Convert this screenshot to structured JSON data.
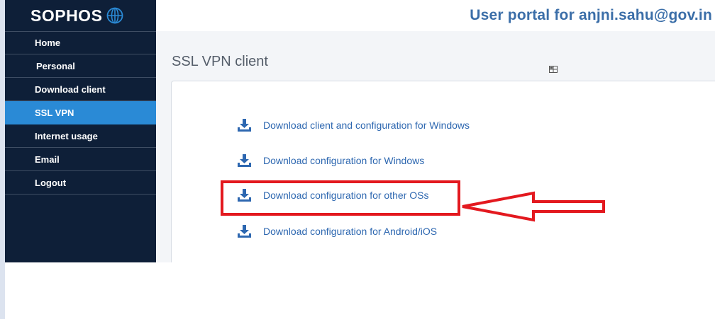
{
  "brand": {
    "logo_text": "SOPHOS",
    "logo_icon": "globe-icon"
  },
  "header": {
    "portal_title": "User portal for anjni.sahu@gov.in"
  },
  "sidebar": {
    "items": [
      {
        "label": "Home",
        "active": false
      },
      {
        "label": "Personal",
        "active": false
      },
      {
        "label": "Download client",
        "active": false
      },
      {
        "label": "SSL VPN",
        "active": true
      },
      {
        "label": "Internet usage",
        "active": false
      },
      {
        "label": "Email",
        "active": false
      },
      {
        "label": "Logout",
        "active": false
      }
    ]
  },
  "main": {
    "page_title": "SSL VPN client",
    "links": [
      {
        "label": "Download client and configuration for Windows",
        "icon": "download-icon"
      },
      {
        "label": "Download configuration for Windows",
        "icon": "download-icon"
      },
      {
        "label": "Download configuration for other OSs",
        "icon": "download-icon"
      },
      {
        "label": "Download configuration for Android/iOS",
        "icon": "download-icon"
      }
    ]
  },
  "annotation": {
    "highlighted_link_index": 2,
    "color": "#e3191f"
  },
  "colors": {
    "sidebar_bg": "#0e1f38",
    "active_item": "#2a8ad6",
    "link": "#2d67b0",
    "portal_title": "#3b6ea8"
  }
}
